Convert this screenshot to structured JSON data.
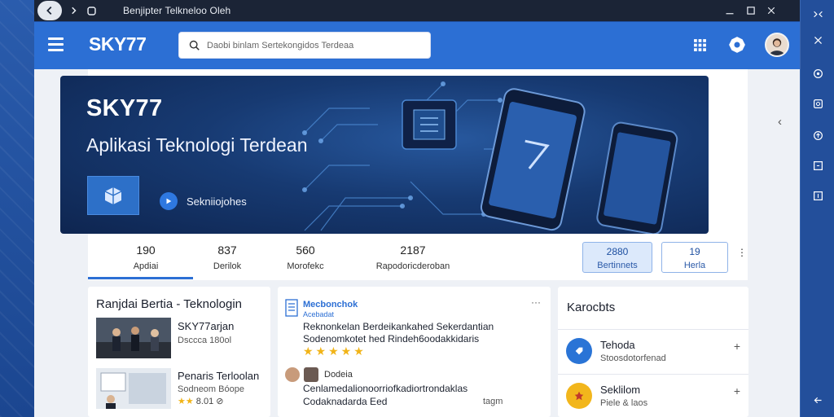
{
  "window": {
    "title": "Benjipter Telkneloo Oleh"
  },
  "header": {
    "logo": "SKY77",
    "search_placeholder": "Daobi binlam Sertekongidos Terdeaa"
  },
  "hero": {
    "title": "SKY77",
    "subtitle": "Aplikasi Teknologi Terdean",
    "badge_label": "Sekniiojohes"
  },
  "stats": [
    {
      "num": "190",
      "label": "Apdiai"
    },
    {
      "num": "837",
      "label": "Derilok"
    },
    {
      "num": "560",
      "label": "Morofekc"
    },
    {
      "num": "2187",
      "label": "Rapodoricderoban"
    }
  ],
  "stat_boxes": [
    {
      "num": "2880",
      "label": "Bertinnets"
    },
    {
      "num": "19",
      "label": "Herla"
    }
  ],
  "news": {
    "title": "Ranjdai Bertia - Teknologin",
    "items": [
      {
        "headline": "SKY77arjan",
        "meta": "Dsccca 180ol"
      },
      {
        "headline": "Penaris Terloolan",
        "meta": "Sodneom Bóope",
        "meta2": "8.01"
      }
    ]
  },
  "reviews": {
    "header_title": "Mecbonchok",
    "header_sub": "Acebadat",
    "line1": "Reknonkelan Berdeikankahed Sekerdantian",
    "line2": "Sodenomkotet hed Rindeh6oodakkidaris",
    "reviewer": "Dodeia",
    "line3": "Cenlamedaliono­orriofkadiortrondaklas",
    "line4": "Codaknadarda Eed",
    "line4_right": "tagm",
    "menu": "···"
  },
  "categories": {
    "title": "Karocbts",
    "items": [
      {
        "name": "Tehoda",
        "sub": "Stoosdotorfenad",
        "color": "#2a74d6"
      },
      {
        "name": "Seklilom",
        "sub": "Piele & laos",
        "color": "#f2b61c"
      }
    ]
  },
  "colors": {
    "accent": "#2c6fd4",
    "titlebar": "#1b2436",
    "hero_bg": "#173a72",
    "star": "#f1b418"
  },
  "icons": {
    "back": "arrow-left",
    "forward": "chevron-right",
    "reload": "reload",
    "search": "magnifier",
    "apps": "grid",
    "settings": "gear",
    "rail": [
      "shuffle",
      "cross-arrows",
      "circle-dot",
      "upload-box",
      "arrow-up-circle",
      "share-box",
      "download-box",
      "arrow-left"
    ]
  }
}
